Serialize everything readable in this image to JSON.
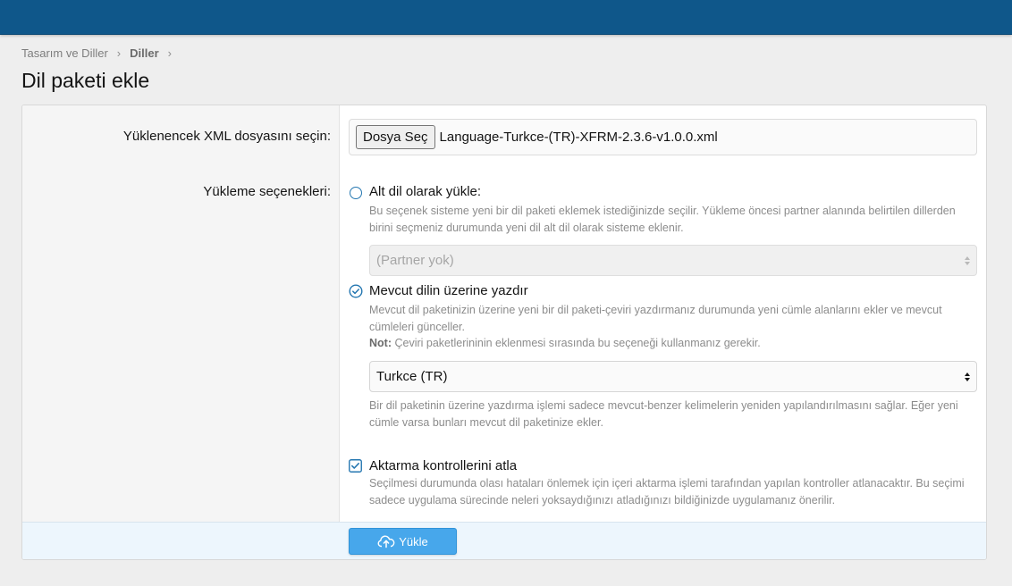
{
  "breadcrumb": {
    "items": [
      "Tasarım ve Diller",
      "Diller"
    ],
    "separator": "›"
  },
  "page": {
    "title": "Dil paketi ekle"
  },
  "form": {
    "upload": {
      "label": "Yüklenencek XML dosyasını seçin:",
      "button_label": "Dosya Seç",
      "file_name": "Language-Turkce-(TR)-XFRM-2.3.6-v1.0.0.xml"
    },
    "options": {
      "label": "Yükleme seçenekleri:",
      "child": {
        "label": "Alt dil olarak yükle:",
        "selected": false,
        "hint": "Bu seçenek sisteme yeni bir dil paketi eklemek istediğinizde seçilir. Yükleme öncesi partner alanında belirtilen dillerden birini seçmeniz durumunda yeni dil alt dil olarak sisteme eklenir.",
        "select_value": "(Partner yok)",
        "select_disabled": true
      },
      "overwrite": {
        "label": "Mevcut dilin üzerine yazdır",
        "selected": true,
        "hint": "Mevcut dil paketinizin üzerine yeni bir dil paketi-çeviri yazdırmanız durumunda yeni cümle alanlarını ekler ve mevcut cümleleri günceller.",
        "note_label": "Not:",
        "note_text": " Çeviri paketlerininin eklenmesi sırasında bu seçeneği kullanmanız gerekir.",
        "select_value": "Turkce (TR)",
        "after_hint": "Bir dil paketinin üzerine yazdırma işlemi sadece mevcut-benzer kelimelerin yeniden yapılandırılmasını sağlar. Eğer yeni cümle varsa bunları mevcut dil paketinize ekler."
      },
      "skip_checks": {
        "label": "Aktarma kontrollerini atla",
        "checked": true,
        "hint": "Seçilmesi durumunda olası hataları önlemek için içeri aktarma işlemi tarafından yapılan kontroller atlanacaktır. Bu seçimi sadece uygulama sürecinde neleri yoksaydığınızı atladığınızı bildiğinizde uygulamanız önerilir."
      }
    },
    "submit_label": "Yükle"
  },
  "colors": {
    "header_bar": "#0f578a",
    "accent": "#2577b1",
    "button": "#47a7eb"
  },
  "icons": {
    "radio_checked": "check-circle-icon",
    "checkbox_checked": "checkbox-check-icon",
    "submit": "cloud-upload-icon",
    "select": "select-arrows-icon"
  }
}
